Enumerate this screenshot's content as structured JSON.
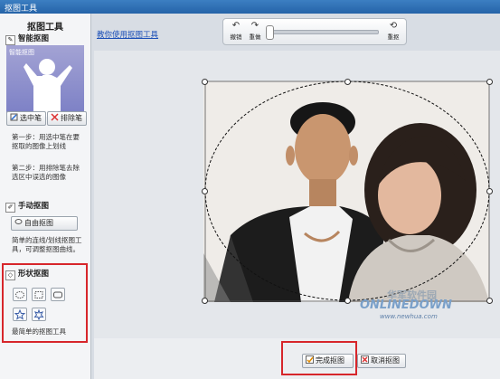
{
  "window": {
    "title": "抠图工具"
  },
  "sidebar": {
    "title": "抠图工具",
    "smart": {
      "heading": "智能抠图",
      "thumb_label": "智能抠图",
      "select_pen": "选中笔",
      "erase_pen": "排除笔",
      "step1": "第一步：用选中笔在要抠取的图像上划线",
      "step2": "第二步：用排除笔去除选区中误选的图像"
    },
    "manual": {
      "heading": "手动抠图",
      "free_button": "自由抠图",
      "desc": "简单的连线/划线抠图工具，可调整抠图曲线。"
    },
    "shape": {
      "heading": "形状抠图",
      "desc": "最简单的抠图工具",
      "shapes": [
        "ellipse-icon",
        "rectangle-icon",
        "rounded-rect-icon",
        "star-icon",
        "gear-star-icon"
      ]
    }
  },
  "header": {
    "help_link": "教你使用抠图工具"
  },
  "toolbar": {
    "undo": "撤销",
    "redo": "重做",
    "reset": "重抠",
    "zoom_level": 0.0
  },
  "watermark": {
    "cn": "华军软件园",
    "en": "ONLINEDOWN",
    "url": "www.newhua.com"
  },
  "footer": {
    "done": "完成抠图",
    "cancel": "取消抠图"
  },
  "colors": {
    "title_bar": "#2f70b6",
    "highlight": "#d7262b",
    "link": "#1b4fb7"
  }
}
